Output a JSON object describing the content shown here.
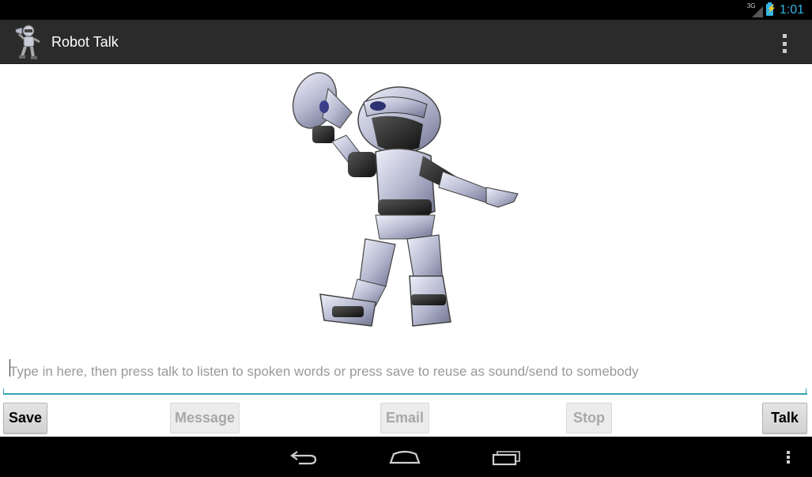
{
  "status_bar": {
    "network_label": "3G",
    "time": "1:01",
    "icons": [
      "signal-icon",
      "battery-charging-icon"
    ]
  },
  "action_bar": {
    "app_icon": "robot-app-icon",
    "title": "Robot Talk",
    "overflow_icon": "overflow-menu-icon"
  },
  "main": {
    "image": "robot-with-megaphone",
    "text_input": {
      "value": "",
      "placeholder": "Type in here, then press talk to listen to spoken words or press save to reuse as sound/send to somebody"
    },
    "buttons": [
      {
        "label": "Save",
        "enabled": true
      },
      {
        "label": "Message",
        "enabled": false
      },
      {
        "label": "Email",
        "enabled": false
      },
      {
        "label": "Stop",
        "enabled": false
      },
      {
        "label": "Talk",
        "enabled": true
      }
    ]
  },
  "nav_bar": {
    "icons": [
      "back-icon",
      "home-icon",
      "recent-apps-icon",
      "menu-icon"
    ]
  },
  "colors": {
    "accent": "#33b5e5",
    "text_field_underline": "#33a3b5",
    "action_bar_bg": "#2b2b2b"
  }
}
